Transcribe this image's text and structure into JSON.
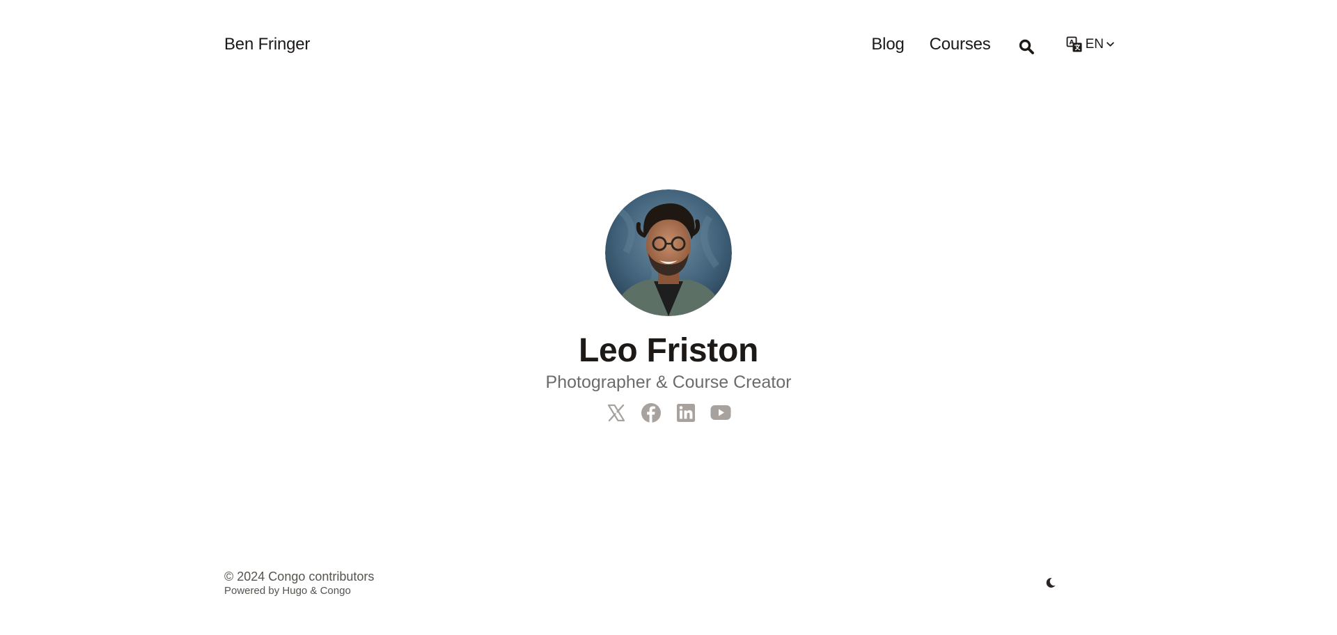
{
  "header": {
    "brand": "Ben Fringer",
    "nav": [
      {
        "label": "Blog"
      },
      {
        "label": "Courses"
      }
    ],
    "search_icon": "search-icon",
    "language": {
      "icon": "translate-icon",
      "label": "EN",
      "chevron": "chevron-down-icon"
    }
  },
  "profile": {
    "avatar_alt": "avatar",
    "name": "Leo Friston",
    "tagline": "Photographer & Course Creator",
    "socials": [
      {
        "icon": "x-twitter-icon"
      },
      {
        "icon": "facebook-icon"
      },
      {
        "icon": "linkedin-icon"
      },
      {
        "icon": "youtube-icon"
      }
    ],
    "social_color": "#a8a29e"
  },
  "footer": {
    "copyright": "© 2024 Congo contributors",
    "powered_prefix": "Powered by ",
    "powered_hugo": "Hugo",
    "powered_amp": " & ",
    "powered_congo": "Congo",
    "theme_toggle_icon": "moon-icon"
  }
}
